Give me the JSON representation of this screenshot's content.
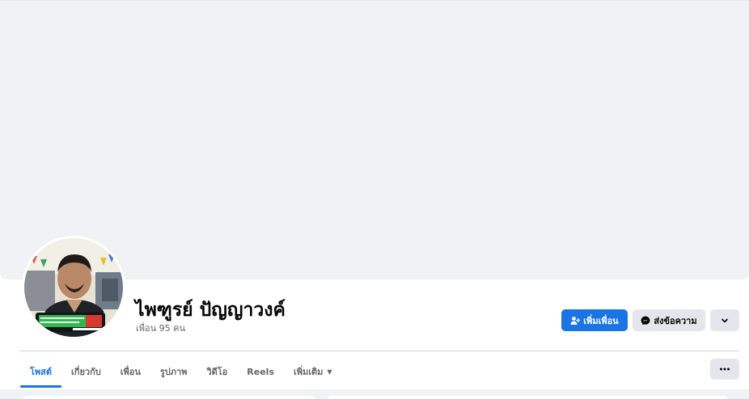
{
  "profile": {
    "name": "ไพฑูรย์ ปัญญาวงค์",
    "friends_count": "เพื่อน 95 คน"
  },
  "actions": {
    "add_friend_label": "เพิ่มเพื่อน",
    "message_label": "ส่งข้อความ"
  },
  "tabs": [
    {
      "label": "โพสต์",
      "active": true
    },
    {
      "label": "เกี่ยวกับ",
      "active": false
    },
    {
      "label": "เพื่อน",
      "active": false
    },
    {
      "label": "รูปภาพ",
      "active": false
    },
    {
      "label": "วิดีโอ",
      "active": false
    },
    {
      "label": "Reels",
      "active": false
    },
    {
      "label": "เพิ่มเติม",
      "active": false
    }
  ],
  "colors": {
    "accent": "#1b74e4",
    "secondary_button": "#e4e6eb",
    "cover": "#f0f2f5",
    "muted_text": "#65676b"
  },
  "icons": {
    "add_friend": "person-plus-icon",
    "message": "messenger-icon",
    "profile_menu": "chevron-down-icon",
    "more_tab": "caret-down-icon",
    "tab_menu": "ellipsis-icon"
  }
}
